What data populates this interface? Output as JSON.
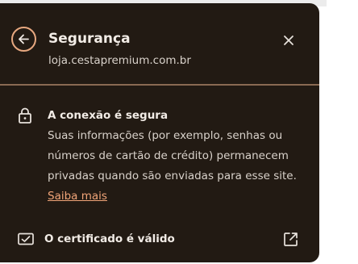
{
  "header": {
    "title": "Segurança",
    "site": "loja.cestapremium.com.br"
  },
  "connection": {
    "title": "A conexão é segura",
    "description_lines": [
      "Suas informações (por exemplo, senhas ou",
      "números de cartão de crédito) permanecem",
      "privadas quando são enviadas para esse site."
    ],
    "learn_more": "Saiba mais"
  },
  "certificate": {
    "label": "O certificado é válido"
  },
  "icons": {
    "back": "back-arrow-icon",
    "close": "close-icon",
    "lock": "lock-icon",
    "certificate": "certificate-icon",
    "external": "external-link-icon"
  },
  "colors": {
    "panel_bg": "#221a13",
    "accent": "#e7a880",
    "link": "#f0a478",
    "divider": "#8a6a52"
  }
}
